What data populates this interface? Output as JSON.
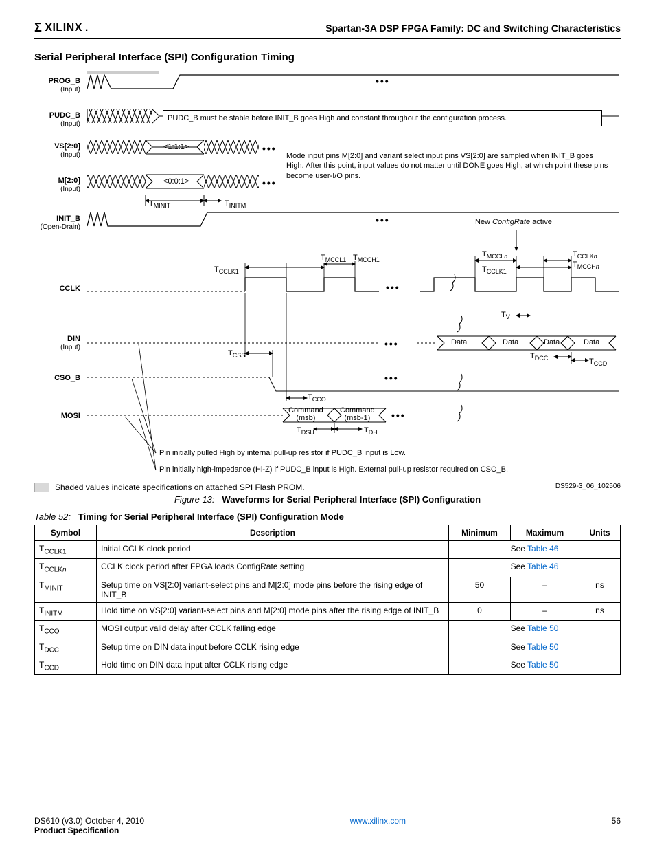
{
  "header": {
    "logo_text": "XILINX",
    "doc_title": "Spartan-3A DSP FPGA Family: DC and Switching Characteristics"
  },
  "section_title": "Serial Peripheral Interface (SPI) Configuration Timing",
  "diagram": {
    "signals": {
      "prog_b": {
        "name": "PROG_B",
        "sub": "(Input)"
      },
      "pudc_b": {
        "name": "PUDC_B",
        "sub": "(Input)"
      },
      "vs": {
        "name": "VS[2:0]",
        "sub": "(Input)"
      },
      "m": {
        "name": "M[2:0]",
        "sub": "(Input)"
      },
      "init_b": {
        "name": "INIT_B",
        "sub": "(Open-Drain)"
      },
      "cclk": {
        "name": "CCLK",
        "sub": ""
      },
      "din": {
        "name": "DIN",
        "sub": "(Input)"
      },
      "cso_b": {
        "name": "CSO_B",
        "sub": ""
      },
      "mosi": {
        "name": "MOSI",
        "sub": ""
      }
    },
    "pudc_note": "PUDC_B must be stable before INIT_B goes High and constant throughout the configuration process.",
    "vs_value": "<1:1:1>",
    "m_value": "<0:0:1>",
    "mode_note": "Mode input pins M[2:0] and variant select input pins VS[2:0] are sampled when INIT_B goes High.  After this point, input values do not matter until DONE goes High, at which point these pins become user-I/O pins.",
    "config_rate": "New ConfigRate active",
    "data_label": "Data",
    "cmd_msb": "Command\n(msb)",
    "cmd_msb1": "Command\n(msb-1)",
    "pin_note1": "Pin initially pulled High by internal pull-up resistor if PUDC_B input is Low.",
    "pin_note2": "Pin initially high-impedance (Hi-Z) if PUDC_B input is High. External pull-up resistor required on CSO_B.",
    "tparams": {
      "tminit": "MINIT",
      "tinitm": "INITM",
      "tcclk1": "CCLK1",
      "tmccl1": "MCCL1",
      "tmcch1": "MCCH1",
      "tmccln": "MCCLn",
      "tcclkn": "CCLKn",
      "tmcchn": "MCCHn",
      "tv": "V",
      "tcss": "CSS",
      "tdcc": "DCC",
      "tccd": "CCD",
      "tcco": "CCO",
      "tdsu": "DSU",
      "tdh": "DH"
    }
  },
  "shaded_note": "Shaded values indicate specifications on attached SPI Flash PROM.",
  "ds_ref": "DS529-3_06_102506",
  "figure": {
    "label": "Figure 13:",
    "title": "Waveforms for Serial Peripheral Interface (SPI) Configuration"
  },
  "table": {
    "label": "Table  52:",
    "title": "Timing for Serial Peripheral Interface (SPI) Configuration Mode",
    "headers": {
      "symbol": "Symbol",
      "description": "Description",
      "minimum": "Minimum",
      "maximum": "Maximum",
      "units": "Units"
    },
    "rows": [
      {
        "sym_base": "T",
        "sym_sub": "CCLK1",
        "desc": "Initial CCLK clock period",
        "see_prefix": "See ",
        "see_link": "Table 46"
      },
      {
        "sym_base": "T",
        "sym_sub": "CCLKn",
        "sym_sub_italic_last": true,
        "desc": "CCLK clock period after FPGA loads ConfigRate setting",
        "see_prefix": "See ",
        "see_link": "Table 46"
      },
      {
        "sym_base": "T",
        "sym_sub": "MINIT",
        "desc": "Setup time on VS[2:0] variant-select pins and M[2:0] mode pins before the rising edge of INIT_B",
        "min": "50",
        "max": "–",
        "units": "ns"
      },
      {
        "sym_base": "T",
        "sym_sub": "INITM",
        "desc": "Hold time on VS[2:0] variant-select pins and M[2:0] mode pins after the rising edge of INIT_B",
        "min": "0",
        "max": "–",
        "units": "ns"
      },
      {
        "sym_base": "T",
        "sym_sub": "CCO",
        "desc": "MOSI output valid delay after CCLK falling edge",
        "see_prefix": "See ",
        "see_link": "Table 50"
      },
      {
        "sym_base": "T",
        "sym_sub": "DCC",
        "desc": "Setup time on DIN data input before CCLK rising edge",
        "see_prefix": "See ",
        "see_link": "Table 50"
      },
      {
        "sym_base": "T",
        "sym_sub": "CCD",
        "desc": "Hold time on DIN data input after CCLK rising edge",
        "see_prefix": "See ",
        "see_link": "Table 50"
      }
    ]
  },
  "footer": {
    "left_line1": "DS610 (v3.0) October 4, 2010",
    "left_line2": "Product Specification",
    "center_link": "www.xilinx.com",
    "right": "56"
  }
}
